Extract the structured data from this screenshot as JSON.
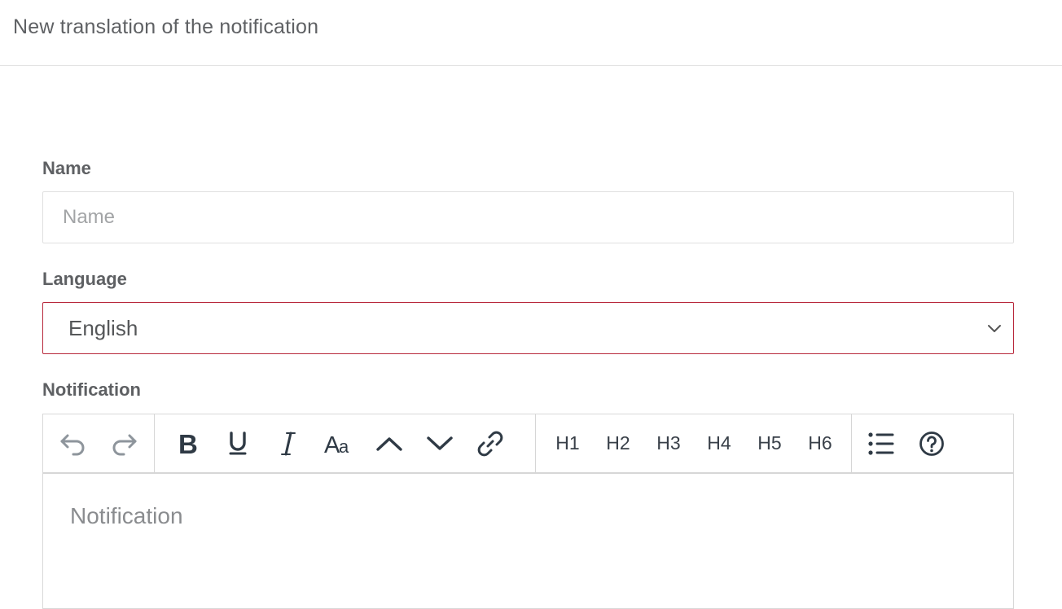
{
  "header": {
    "title": "New translation of the notification"
  },
  "form": {
    "name": {
      "label": "Name",
      "placeholder": "Name",
      "value": ""
    },
    "language": {
      "label": "Language",
      "selected": "English"
    },
    "notification": {
      "label": "Notification",
      "placeholder": "Notification",
      "toolbar": {
        "history": [
          "undo-icon",
          "redo-icon"
        ],
        "formatting": [
          "bold-icon",
          "underline-icon",
          "italic-icon",
          "font-size-icon",
          "superscript-icon",
          "subscript-icon",
          "link-icon"
        ],
        "headings": [
          "H1",
          "H2",
          "H3",
          "H4",
          "H5",
          "H6"
        ],
        "other": [
          "bullet-list-icon",
          "help-icon"
        ]
      }
    }
  },
  "colors": {
    "error_border": "#b8283c",
    "text": "#5e6063",
    "placeholder": "#a2a4a6"
  }
}
